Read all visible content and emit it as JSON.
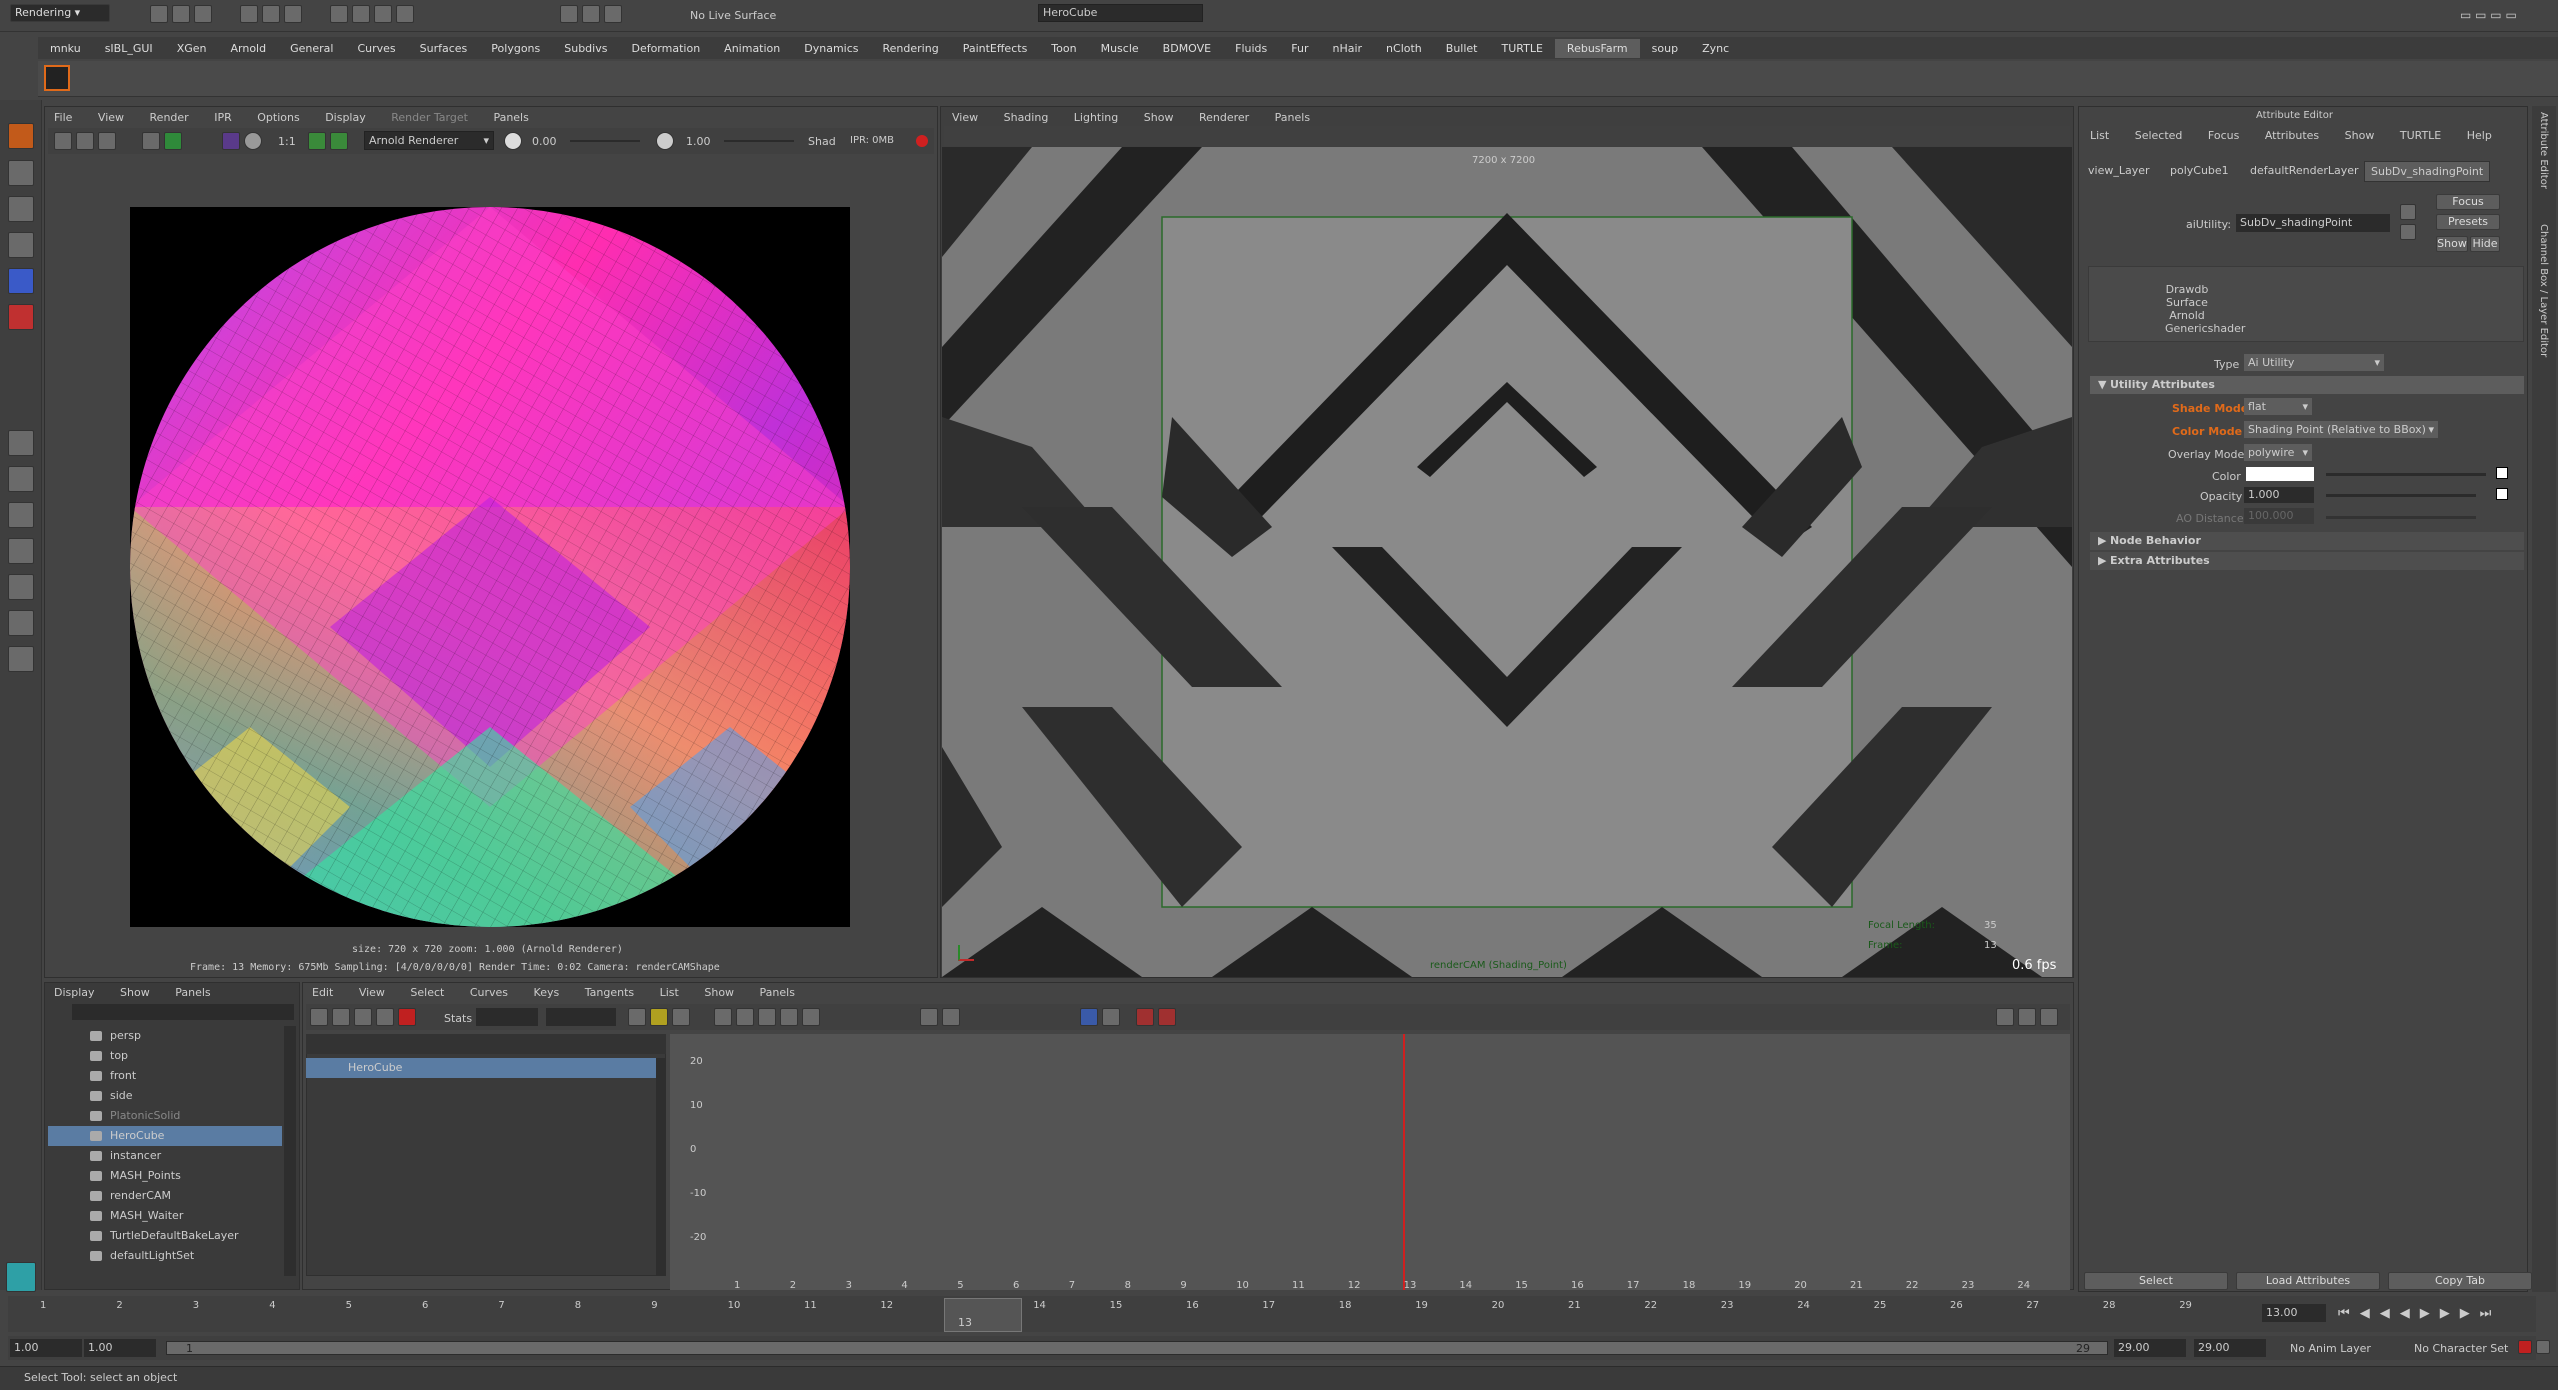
{
  "top": {
    "mode_select": "Rendering",
    "live_surface": "No Live Surface",
    "object_field": "HeroCube"
  },
  "shelf_tabs": [
    "mnku",
    "sIBL_GUI",
    "XGen",
    "Arnold",
    "General",
    "Curves",
    "Surfaces",
    "Polygons",
    "Subdivs",
    "Deformation",
    "Animation",
    "Dynamics",
    "Rendering",
    "PaintEffects",
    "Toon",
    "Muscle",
    "BDMOVE",
    "Fluids",
    "Fur",
    "nHair",
    "nCloth",
    "Bullet",
    "TURTLE",
    "RebusFarm",
    "soup",
    "Zync"
  ],
  "render_view": {
    "menus": [
      "File",
      "View",
      "Render",
      "IPR",
      "Options",
      "Display",
      "Render Target",
      "Panels"
    ],
    "renderer": "Arnold Renderer",
    "exposure": "0.00",
    "gamma": "1.00",
    "shad_label": "Shad",
    "ipr_label": "IPR: 0MB",
    "ratio": "1:1",
    "info_line1": "size: 720 x 720 zoom: 1.000    (Arnold Renderer)",
    "info_line2": "Frame: 13    Memory: 675Mb    Sampling: [4/0/0/0/0/0]    Render Time: 0:02    Camera: renderCAMShape"
  },
  "viewport": {
    "menus": [
      "View",
      "Shading",
      "Lighting",
      "Show",
      "Renderer",
      "Panels"
    ],
    "resolution": "7200 x 7200",
    "focal_label": "Focal Length:",
    "focal_value": "35",
    "frame_label": "Frame:",
    "frame_value": "13",
    "fps": "0.6 fps",
    "camera_label": "renderCAM (Shading_Point)"
  },
  "attribute_editor": {
    "title": "Attribute Editor",
    "menus": [
      "List",
      "Selected",
      "Focus",
      "Attributes",
      "Show",
      "TURTLE",
      "Help"
    ],
    "tabs": [
      "view_Layer",
      "polyCube1",
      "defaultRenderLayer",
      "SubDv_shadingPoint"
    ],
    "node_label": "aiUtility:",
    "node_value": "SubDv_shadingPoint",
    "focus_btn": "Focus",
    "presets_btn": "Presets",
    "show_btn": "Show",
    "hide_btn": "Hide",
    "swatch_lines": [
      "Drawdb",
      "Surface",
      "Arnold",
      "Genericshader"
    ],
    "type_label": "Type",
    "type_value": "Ai Utility",
    "section_utility": "Utility Attributes",
    "shade_mode_label": "Shade Mode",
    "shade_mode_value": "flat",
    "color_mode_label": "Color Mode",
    "color_mode_value": "Shading Point (Relative to BBox)",
    "overlay_label": "Overlay Mode",
    "overlay_value": "polywire",
    "color_label": "Color",
    "opacity_label": "Opacity",
    "opacity_value": "1.000",
    "ao_label": "AO Distance",
    "ao_value": "100.000",
    "section_node": "Node Behavior",
    "section_extra": "Extra Attributes",
    "select_btn": "Select",
    "load_btn": "Load Attributes",
    "copy_btn": "Copy Tab",
    "side_tabs": [
      "Attribute Editor",
      "Channel Box / Layer Editor"
    ]
  },
  "outliner": {
    "menus": [
      "Display",
      "Show",
      "Panels"
    ],
    "items": [
      "persp",
      "top",
      "front",
      "side",
      "PlatonicSolid",
      "HeroCube",
      "instancer",
      "MASH_Points",
      "renderCAM",
      "MASH_Waiter",
      "TurtleDefaultBakeLayer",
      "defaultLightSet"
    ],
    "selected": "HeroCube"
  },
  "graph_editor": {
    "menus": [
      "Edit",
      "View",
      "Select",
      "Curves",
      "Keys",
      "Tangents",
      "List",
      "Show",
      "Panels"
    ],
    "stats_label": "Stats",
    "curve_item": "HeroCube",
    "y_ticks": [
      "20",
      "10",
      "0",
      "-10",
      "-20"
    ],
    "x_ticks": [
      "1",
      "2",
      "3",
      "4",
      "5",
      "6",
      "7",
      "8",
      "9",
      "10",
      "11",
      "12",
      "13",
      "14",
      "15",
      "16",
      "17",
      "18",
      "19",
      "20",
      "21",
      "22",
      "23",
      "24"
    ],
    "current_frame": "13"
  },
  "timeline": {
    "ticks": [
      "1",
      "2",
      "3",
      "4",
      "5",
      "6",
      "7",
      "8",
      "9",
      "10",
      "11",
      "12",
      "13",
      "14",
      "15",
      "16",
      "17",
      "18",
      "19",
      "20",
      "21",
      "22",
      "23",
      "24",
      "25",
      "26",
      "27",
      "28",
      "29"
    ],
    "current": "13",
    "current_field": "13.00",
    "start": "1.00",
    "start2": "1.00",
    "range_start": "1",
    "range_end": "29",
    "end": "29.00",
    "end2": "29.00",
    "anim_layer": "No Anim Layer",
    "char_set": "No Character Set"
  },
  "help_line": "Select Tool: select an object",
  "colors": {
    "accent": "#e06a1a",
    "selection": "#5a7ca3",
    "panel": "#444444",
    "field": "#2b2b2b",
    "highlight": "#e06a1a",
    "timeline_red": "#d02020"
  }
}
